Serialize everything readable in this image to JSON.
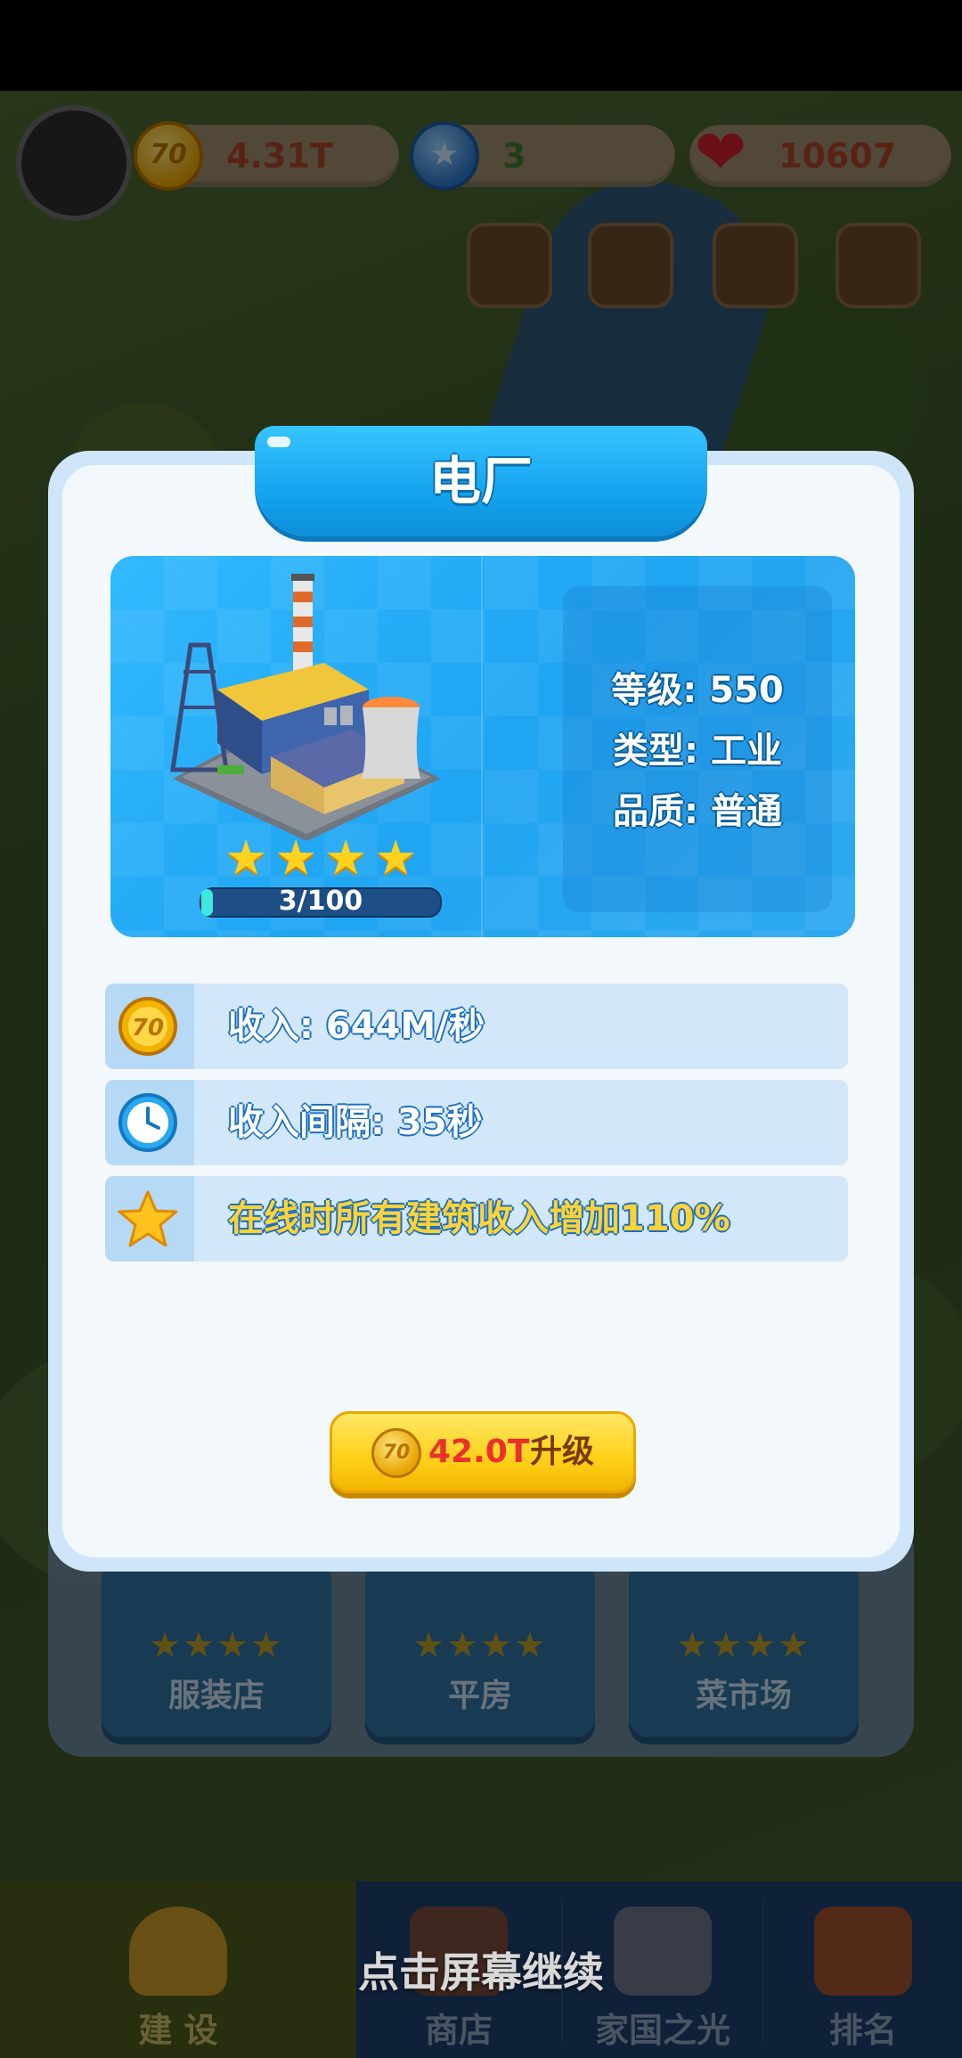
{
  "hud": {
    "coins": "4.31T",
    "gems": "3",
    "hearts": "10607"
  },
  "dialog": {
    "title": "电厂",
    "stars": 4,
    "progress": {
      "text": "3/100",
      "fraction": 0.03
    },
    "stats": {
      "level": "等级: 550",
      "type": "类型: 工业",
      "quality": "品质: 普通"
    },
    "rows": [
      {
        "icon": "coin-icon",
        "text": "收入: 644M/秒"
      },
      {
        "icon": "clock-icon",
        "text": "收入间隔: 35秒"
      },
      {
        "icon": "star-icon",
        "text": "在线时所有建筑收入增加110%"
      }
    ],
    "upgrade": {
      "cost": "42.0T",
      "label": "升级"
    }
  },
  "cards": [
    {
      "name": "服装店",
      "stars": "★★★★"
    },
    {
      "name": "平房",
      "stars": "★★★★"
    },
    {
      "name": "菜市场",
      "stars": "★★★★"
    }
  ],
  "bottom_nav": [
    {
      "label": "建 设"
    },
    {
      "label": "商店"
    },
    {
      "label": "家国之光"
    },
    {
      "label": "排名"
    }
  ],
  "continue_hint": "点击屏幕继续",
  "colors": {
    "accent": "#1fa5f2",
    "button": "#ffd21c",
    "cost": "#e8312d"
  }
}
